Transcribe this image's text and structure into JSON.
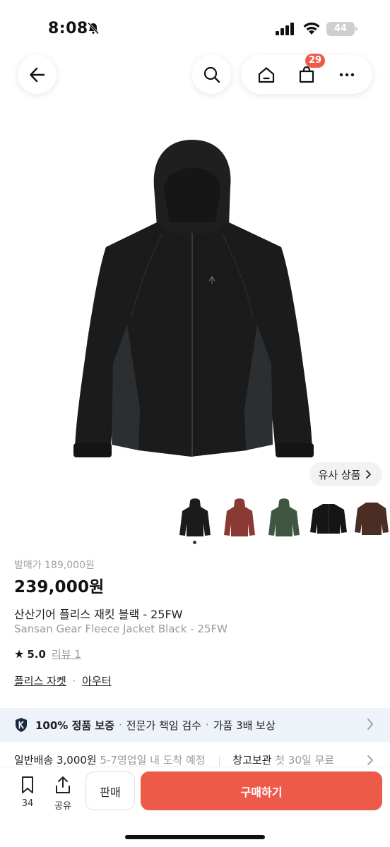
{
  "status_bar": {
    "time": "8:08",
    "battery": "44"
  },
  "header": {
    "cart_count": "29"
  },
  "similar_button": {
    "label": "유사 상품"
  },
  "thumbnails": [
    {
      "color": "#1b1b1b",
      "name": "black"
    },
    {
      "color": "#8a3a34",
      "name": "red"
    },
    {
      "color": "#3f5641",
      "name": "green"
    },
    {
      "color": "#151515",
      "name": "black-fleece"
    },
    {
      "color": "#4b2d24",
      "name": "brown"
    }
  ],
  "product": {
    "original_price": "발매가 189,000원",
    "price": "239,000원",
    "title_ko": "산산기어 플리스 재킷 블랙 - 25FW",
    "title_en": "Sansan Gear Fleece Jacket Black - 25FW",
    "rating": "5.0",
    "review_link": "리뷰 1",
    "category_primary": "플리스 자켓",
    "category_sep": "·",
    "category_secondary": "아우터"
  },
  "guarantee": {
    "item1": "100% 정품 보증",
    "item2": "전문가 책임 검수",
    "item3": "가품 3배 보상",
    "dot": "·"
  },
  "shipping": {
    "type": "일반배송 3,000원",
    "eta": "5-7영업일 내 도착 예정",
    "storage": "창고보관",
    "storage_note": "첫 30일 무료"
  },
  "bottom_bar": {
    "bookmark_count": "34",
    "share_label": "공유",
    "sell_label": "판매",
    "buy_label": "구매하기"
  },
  "colors": {
    "accent": "#ee5a4a",
    "banner_bg": "#eef3fa"
  }
}
